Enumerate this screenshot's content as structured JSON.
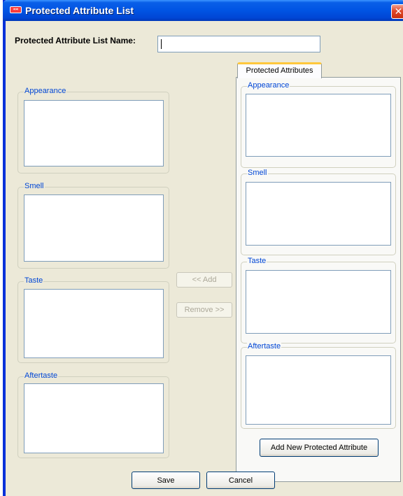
{
  "window": {
    "title": "Protected Attribute List",
    "close_glyph": "✕",
    "icon": "app-icon",
    "icon_text": "≈≈"
  },
  "name_field": {
    "label": "Protected Attribute List Name:",
    "value": ""
  },
  "available": {
    "groups": [
      {
        "label": "Appearance"
      },
      {
        "label": "Smell"
      },
      {
        "label": "Taste"
      },
      {
        "label": "Aftertaste"
      }
    ]
  },
  "transfer": {
    "add_label": "<< Add",
    "remove_label": "Remove >>"
  },
  "protected_tab": {
    "tab_label": "Protected Attributes",
    "groups": [
      {
        "label": "Appearance"
      },
      {
        "label": "Smell"
      },
      {
        "label": "Taste"
      },
      {
        "label": "Aftertaste"
      }
    ],
    "add_new_label": "Add New Protected Attribute"
  },
  "footer": {
    "save_label": "Save",
    "cancel_label": "Cancel"
  },
  "colors": {
    "titlebar": "#0054e3",
    "group_label": "#0046d5",
    "dialog_bg": "#ece9d8",
    "listbox_border": "#7f9db9"
  }
}
